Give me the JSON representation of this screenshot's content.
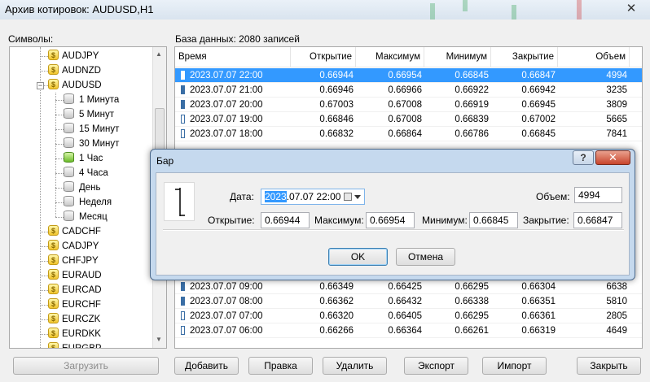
{
  "window": {
    "title": "Архив котировок: AUDUSD,H1",
    "close_glyph": "✕"
  },
  "symbols_label": "Символы:",
  "db_label": "База данных: 2080 записей",
  "tree": {
    "items": [
      {
        "label": "AUDJPY",
        "type": "symbol"
      },
      {
        "label": "AUDNZD",
        "type": "symbol"
      },
      {
        "label": "AUDUSD",
        "type": "symbol",
        "expanded": true,
        "expander": "−"
      },
      {
        "label": "1 Минута",
        "type": "period"
      },
      {
        "label": "5 Минут",
        "type": "period"
      },
      {
        "label": "15 Минут",
        "type": "period"
      },
      {
        "label": "30 Минут",
        "type": "period"
      },
      {
        "label": "1 Час",
        "type": "period",
        "active": true
      },
      {
        "label": "4 Часа",
        "type": "period"
      },
      {
        "label": "День",
        "type": "period"
      },
      {
        "label": "Неделя",
        "type": "period"
      },
      {
        "label": "Месяц",
        "type": "period"
      },
      {
        "label": "CADCHF",
        "type": "symbol"
      },
      {
        "label": "CADJPY",
        "type": "symbol"
      },
      {
        "label": "CHFJPY",
        "type": "symbol"
      },
      {
        "label": "EURAUD",
        "type": "symbol"
      },
      {
        "label": "EURCAD",
        "type": "symbol"
      },
      {
        "label": "EURCHF",
        "type": "symbol"
      },
      {
        "label": "EURCZK",
        "type": "symbol"
      },
      {
        "label": "EURDKK",
        "type": "symbol"
      },
      {
        "label": "EURGBP",
        "type": "symbol"
      }
    ]
  },
  "table": {
    "columns": [
      "Время",
      "Открытие",
      "Максимум",
      "Минимум",
      "Закрытие",
      "Объем"
    ],
    "rows_top": [
      {
        "time": "2023.07.07 22:00",
        "open": "0.66944",
        "high": "0.66954",
        "low": "0.66845",
        "close": "0.66847",
        "vol": "4994",
        "selected": true,
        "bull": false
      },
      {
        "time": "2023.07.07 21:00",
        "open": "0.66946",
        "high": "0.66966",
        "low": "0.66922",
        "close": "0.66942",
        "vol": "3235",
        "bull": false
      },
      {
        "time": "2023.07.07 20:00",
        "open": "0.67003",
        "high": "0.67008",
        "low": "0.66919",
        "close": "0.66945",
        "vol": "3809",
        "bull": false
      },
      {
        "time": "2023.07.07 19:00",
        "open": "0.66846",
        "high": "0.67008",
        "low": "0.66839",
        "close": "0.67002",
        "vol": "5665",
        "bull": true
      },
      {
        "time": "2023.07.07 18:00",
        "open": "0.66832",
        "high": "0.66864",
        "low": "0.66786",
        "close": "0.66845",
        "vol": "7841",
        "bull": true
      }
    ],
    "rows_bottom": [
      {
        "time": "2023.07.07 09:00",
        "open": "0.66349",
        "high": "0.66425",
        "low": "0.66295",
        "close": "0.66304",
        "vol": "6638",
        "bull": false
      },
      {
        "time": "2023.07.07 08:00",
        "open": "0.66362",
        "high": "0.66432",
        "low": "0.66338",
        "close": "0.66351",
        "vol": "5810",
        "bull": false
      },
      {
        "time": "2023.07.07 07:00",
        "open": "0.66320",
        "high": "0.66405",
        "low": "0.66295",
        "close": "0.66361",
        "vol": "2805",
        "bull": true
      },
      {
        "time": "2023.07.07 06:00",
        "open": "0.66266",
        "high": "0.66364",
        "low": "0.66261",
        "close": "0.66319",
        "vol": "4649",
        "bull": true
      }
    ]
  },
  "buttons": {
    "load": "Загрузить",
    "add": "Добавить",
    "edit": "Правка",
    "delete": "Удалить",
    "export": "Экспорт",
    "import": "Импорт",
    "close": "Закрыть"
  },
  "dialog": {
    "title": "Бар",
    "help_glyph": "?",
    "close_glyph": "✕",
    "date_label": "Дата:",
    "date_selected": "2023",
    "date_rest": ".07.07 22:00",
    "volume_label": "Объем:",
    "volume_value": "4994",
    "open_label": "Открытие:",
    "open_value": "0.66944",
    "high_label": "Максимум:",
    "high_value": "0.66954",
    "low_label": "Минимум:",
    "low_value": "0.66845",
    "close_label": "Закрытие:",
    "close_value": "0.66847",
    "ok": "OK",
    "cancel": "Отмена"
  },
  "colors": {
    "selection": "#3399ff",
    "dialog_frame": "#c5d9ee",
    "close_red": "#c8452c"
  }
}
